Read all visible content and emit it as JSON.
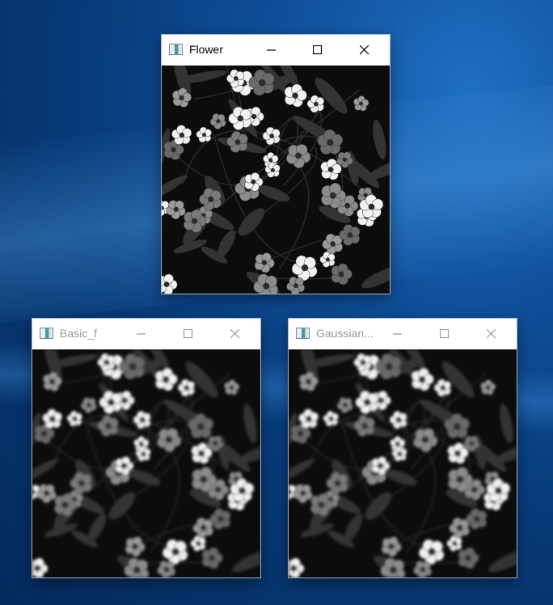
{
  "windows": [
    {
      "title": "Flower",
      "state": "active"
    },
    {
      "title": "Basic_f",
      "state": "inactive"
    },
    {
      "title": "Gaussian...",
      "state": "inactive"
    }
  ],
  "image": {
    "description_icon": "floral-pattern-grayscale"
  }
}
